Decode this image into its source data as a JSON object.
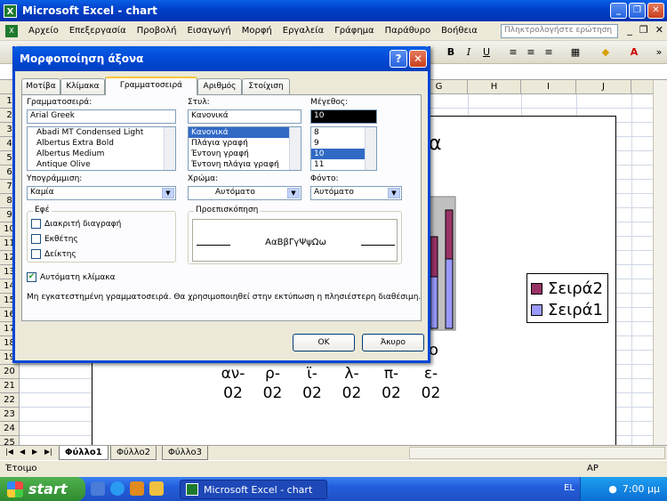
{
  "window": {
    "title": "Microsoft Excel - chart",
    "min": "_",
    "max": "❐",
    "close": "✕"
  },
  "menu": [
    "Αρχείο",
    "Επεξεργασία",
    "Προβολή",
    "Εισαγωγή",
    "Μορφή",
    "Εργαλεία",
    "Γράφημα",
    "Παράθυρο",
    "Βοήθεια"
  ],
  "help_placeholder": "Πληκτρολογήστε ερώτηση",
  "toolbar": {
    "bold": "B",
    "italic": "I",
    "underline": "U"
  },
  "columns": [
    "G",
    "H",
    "I",
    "J"
  ],
  "rows": [
    "1",
    "2",
    "3",
    "4",
    "5",
    "6",
    "7",
    "8",
    "9",
    "10",
    "11",
    "12",
    "13",
    "14",
    "15",
    "16",
    "17",
    "18",
    "19",
    "20",
    "21",
    "22",
    "23",
    "24",
    "25"
  ],
  "chart": {
    "title_fragment": "α",
    "axis_fragment": "ο",
    "x_ticks": [
      [
        "αν-",
        "02"
      ],
      [
        "ρ-",
        "02"
      ],
      [
        "ϊ-",
        "02"
      ],
      [
        "λ-",
        "02"
      ],
      [
        "π-",
        "02"
      ],
      [
        "ε-",
        "02"
      ]
    ],
    "legend": [
      {
        "name": "Σειρά2",
        "color": "#993366"
      },
      {
        "name": "Σειρά1",
        "color": "#9999ff"
      }
    ]
  },
  "chart_data": {
    "type": "bar",
    "categories": [
      "αν-02",
      "ρ-02",
      "ϊ-02",
      "λ-02",
      "π-02",
      "ε-02"
    ],
    "series": [
      {
        "name": "Σειρά2"
      },
      {
        "name": "Σειρά1"
      }
    ]
  },
  "sheets": [
    "Φύλλο1",
    "Φύλλο2",
    "Φύλλο3"
  ],
  "status": {
    "left": "Έτοιμο",
    "right": "ΑΡ"
  },
  "taskbar": {
    "start": "start",
    "task": "Microsoft Excel - chart",
    "lang": "EL",
    "time": "7:00 μμ"
  },
  "dialog": {
    "title": "Μορφοποίηση άξονα",
    "help": "?",
    "close": "✕",
    "tabs": [
      "Μοτίβα",
      "Κλίμακα",
      "Γραμματοσειρά",
      "Αριθμός",
      "Στοίχιση"
    ],
    "font_label": "Γραμματοσειρά:",
    "font_value": "Arial Greek",
    "fonts": [
      "Abadi MT Condensed Light",
      "Albertus Extra Bold",
      "Albertus Medium",
      "Antique Olive"
    ],
    "style_label": "Στυλ:",
    "style_value": "Κανονικά",
    "styles": [
      "Κανονικά",
      "Πλάγια γραφή",
      "Έντονη γραφή",
      "Έντονη πλάγια γραφή"
    ],
    "size_label": "Μέγεθος:",
    "size_value": "10",
    "sizes": [
      "8",
      "9",
      "10",
      "11"
    ],
    "underline_label": "Υπογράμμιση:",
    "underline_value": "Καμία",
    "color_label": "Χρώμα:",
    "color_value": "Αυτόματο",
    "bg_label": "Φόντο:",
    "bg_value": "Αυτόματο",
    "effects_label": "Εφέ",
    "effects": [
      "Διακριτή διαγραφή",
      "Εκθέτης",
      "Δείκτης"
    ],
    "preview_label": "Προεπισκόπηση",
    "preview_text": "ΑαΒβΓγΨψΩω",
    "autoscale_label": "Αυτόματη κλίμακα",
    "note": "Μη εγκατεστημένη γραμματοσειρά. Θα χρησιμοποιηθεί στην εκτύπωση η πλησιέστερη διαθέσιμη.",
    "ok": "OK",
    "cancel": "Άκυρο"
  }
}
